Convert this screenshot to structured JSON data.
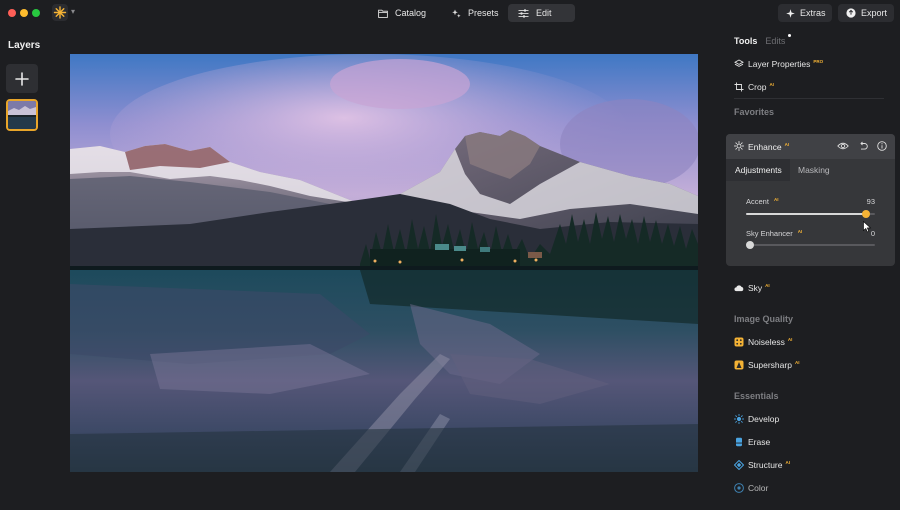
{
  "window": {
    "nav": {
      "catalog": "Catalog",
      "presets": "Presets",
      "edit": "Edit"
    },
    "buttons": {
      "extras": "Extras",
      "export": "Export"
    }
  },
  "layers": {
    "title": "Layers"
  },
  "right_panel": {
    "tabs": {
      "tools": "Tools",
      "edits": "Edits"
    },
    "tools": [
      {
        "label": "Layer Properties",
        "badge": "PRO"
      },
      {
        "label": "Crop",
        "badge": "AI"
      }
    ],
    "sections": {
      "favorites": "Favorites",
      "image_quality": "Image Quality",
      "essentials": "Essentials"
    },
    "enhance": {
      "title": "Enhance",
      "badge": "AI",
      "tabs": {
        "adjustments": "Adjustments",
        "masking": "Masking"
      },
      "sliders": [
        {
          "label": "Accent",
          "badge": "AI",
          "value": "93",
          "fraction": 0.93
        },
        {
          "label": "Sky Enhancer",
          "badge": "AI",
          "value": "0",
          "fraction": 0
        }
      ]
    },
    "sky": {
      "label": "Sky",
      "badge": "AI"
    },
    "image_quality_tools": [
      {
        "label": "Noiseless",
        "badge": "AI"
      },
      {
        "label": "Supersharp",
        "badge": "AI"
      }
    ],
    "essentials_tools": [
      {
        "label": "Develop"
      },
      {
        "label": "Erase"
      },
      {
        "label": "Structure",
        "badge": "AI"
      },
      {
        "label": "Color"
      }
    ]
  },
  "colors": {
    "accent": "#f5b335",
    "background": "#1d1e21",
    "panel": "#36373a",
    "essentials_icon": "#4aa3e0"
  }
}
